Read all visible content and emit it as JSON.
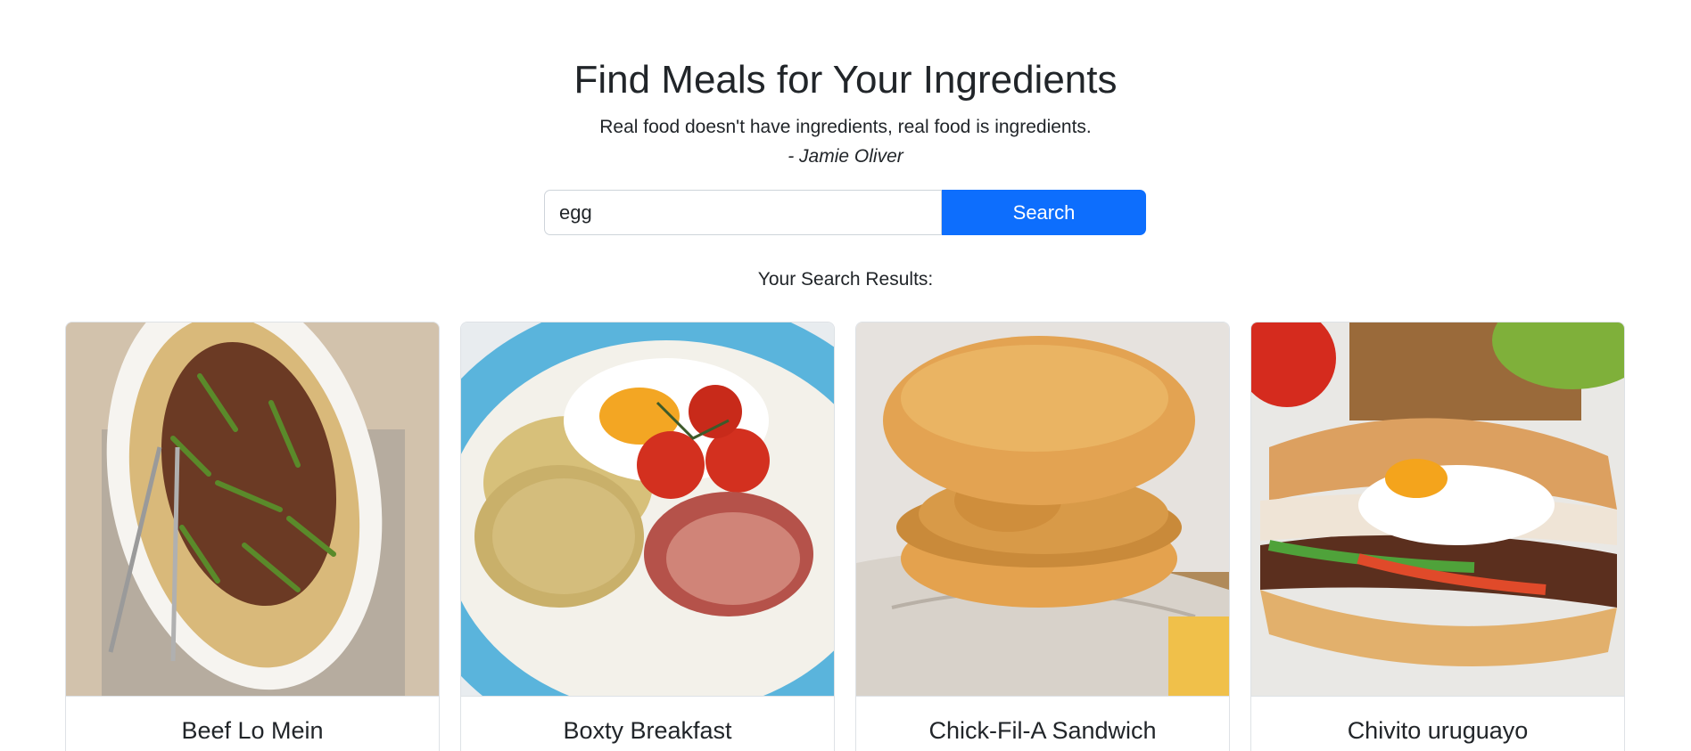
{
  "header": {
    "title": "Find Meals for Your Ingredients",
    "quote": "Real food doesn't have ingredients, real food is ingredients.",
    "author": "- Jamie Oliver"
  },
  "search": {
    "value": "egg",
    "button_label": "Search"
  },
  "results": {
    "label": "Your Search Results:",
    "meals": [
      {
        "name": "Beef Lo Mein"
      },
      {
        "name": "Boxty Breakfast"
      },
      {
        "name": "Chick-Fil-A Sandwich"
      },
      {
        "name": "Chivito uruguayo"
      }
    ]
  },
  "colors": {
    "accent": "#0d6efd",
    "text": "#212529",
    "border": "#dee2e6"
  }
}
